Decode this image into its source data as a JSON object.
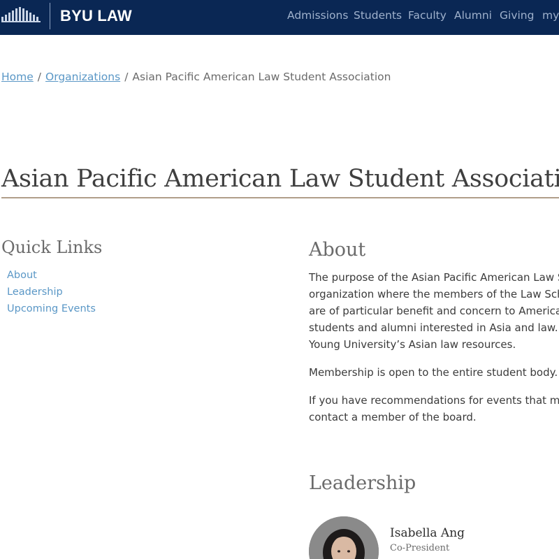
{
  "header": {
    "logo_text": "BYU LAW",
    "logo_icon": "building-columns-logo-icon",
    "background_color": "#0a2754",
    "nav": [
      {
        "label": "Admissions"
      },
      {
        "label": "Students"
      },
      {
        "label": "Faculty"
      },
      {
        "label": "Alumni"
      },
      {
        "label": "Giving"
      },
      {
        "label": "myL"
      }
    ]
  },
  "breadcrumb": {
    "home": "Home",
    "separator_1": "/",
    "organizations": "Organizations",
    "separator_2": "/",
    "current": "Asian Pacific American Law Student Association"
  },
  "page": {
    "title": "Asian Pacific American Law Student Association",
    "accent_rule_color": "#b09e8a",
    "link_color": "#5a97c6"
  },
  "quick_links": {
    "heading": "Quick Links",
    "items": [
      {
        "label": "About"
      },
      {
        "label": "Leadership"
      },
      {
        "label": "Upcoming Events"
      }
    ]
  },
  "about": {
    "heading": "About",
    "paragraph_1_lines": [
      "The purpose of the Asian Pacific American Law S",
      "organization where the members of the Law Sch",
      "are of particular benefit and concern to America",
      "students and alumni interested in Asia and law. S",
      "Young University’s Asian law resources."
    ],
    "paragraph_2": "Membership is open to the entire student body.",
    "paragraph_3_lines": [
      "If you have recommendations for events that ma",
      "contact a member of the board."
    ]
  },
  "leadership": {
    "heading": "Leadership",
    "members": [
      {
        "name": "Isabella Ang",
        "role": "Co-President",
        "avatar_icon": "person-avatar-icon"
      }
    ]
  }
}
